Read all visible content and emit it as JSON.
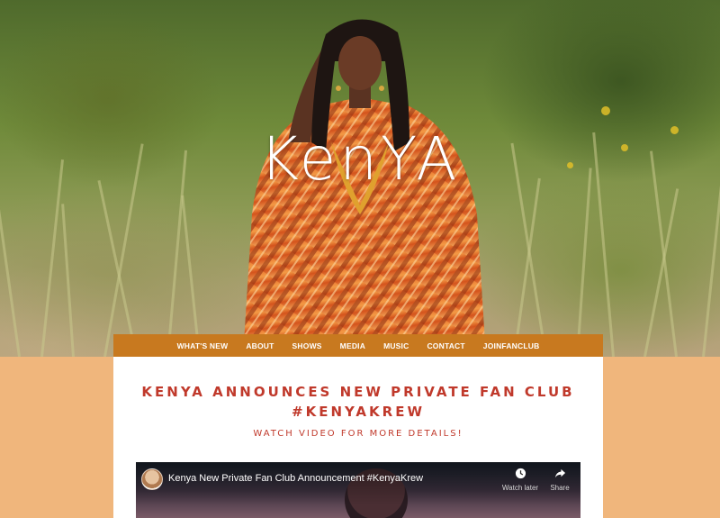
{
  "brand": {
    "name": "KenYA"
  },
  "nav": {
    "items": [
      "WHAT'S NEW",
      "ABOUT",
      "SHOWS",
      "MEDIA",
      "MUSIC",
      "CONTACT",
      "JOINFANCLUB"
    ]
  },
  "article": {
    "headline": "KENYA ANNOUNCES NEW PRIVATE FAN CLUB #KENYAKREW",
    "subheadline": "WATCH VIDEO FOR MORE DETAILS!"
  },
  "video": {
    "title": "Kenya New Private Fan Club Announcement #KenyaKrew",
    "watch_later_label": "Watch later",
    "share_label": "Share",
    "watch_later_icon": "clock-icon",
    "share_icon": "share-icon"
  },
  "colors": {
    "nav_bg": "#c8791f",
    "page_bg": "#f0b67c",
    "headline": "#c0392b",
    "panel": "#ffffff"
  }
}
